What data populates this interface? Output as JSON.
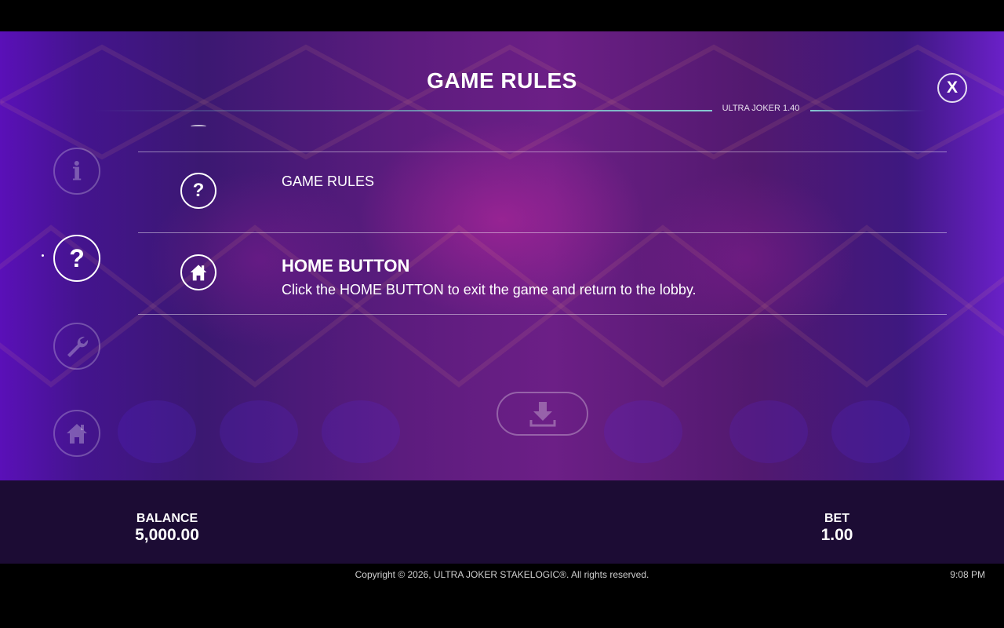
{
  "header": {
    "title": "GAME RULES",
    "version": "ULTRA JOKER 1.40",
    "close_label": "X"
  },
  "sidebar": {
    "items": [
      {
        "icon": "info-icon",
        "glyph": "i",
        "active": false
      },
      {
        "icon": "question-icon",
        "glyph": "?",
        "active": true
      },
      {
        "icon": "wrench-icon",
        "active": false
      },
      {
        "icon": "home-icon",
        "active": false
      }
    ]
  },
  "rules": {
    "items": [
      {
        "icon": "question-icon",
        "glyph": "?",
        "title": "GAME RULES",
        "description": ""
      },
      {
        "icon": "home-icon",
        "title": "HOME BUTTON",
        "description": "Click the HOME BUTTON to exit the game and return to the lobby."
      }
    ]
  },
  "download": {
    "icon": "download-icon"
  },
  "status": {
    "balance_label": "BALANCE",
    "balance_value": "5,000.00",
    "bet_label": "BET",
    "bet_value": "1.00"
  },
  "footer": {
    "copyright": "Copyright © 2026, ULTRA JOKER STAKELOGIC®. All rights reserved.",
    "clock": "9:08 PM"
  },
  "colors": {
    "background_purple": "#5c1c7e",
    "bottom_bar": "#1c0c34",
    "line_teal": "#78c8c8"
  }
}
